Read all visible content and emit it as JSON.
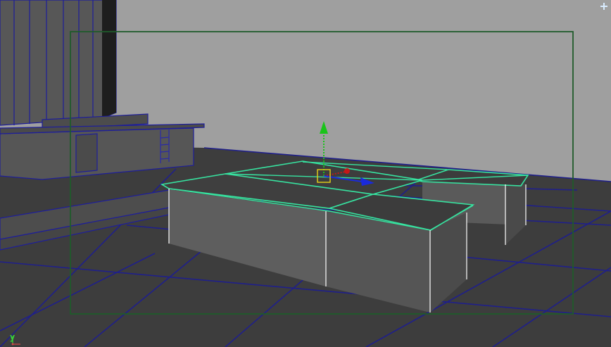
{
  "app": {
    "view": "perspective-viewport"
  },
  "viewport": {
    "axis_indicator_label": "y"
  },
  "colors": {
    "background": "#9b9b9b",
    "ground": "#3c3c3c",
    "grid_line": "#1c1c7a",
    "wall": "#9a9a9a",
    "building": "#565656",
    "building_edge": "#1e1e9a",
    "selected_edge": "#37e3a0",
    "box_top": "#3e3e3e",
    "box_side": "#5e5e5e",
    "resolution_gate": "#1f5b2b",
    "manipulator_y": "#19c419",
    "manipulator_x": "#c51818",
    "manipulator_z": "#1a2adb",
    "pivot": "#e6d316"
  },
  "icons": {
    "move_manipulator": "move-manipulator-icon",
    "corner_indicator": "corner-indicator-icon"
  }
}
